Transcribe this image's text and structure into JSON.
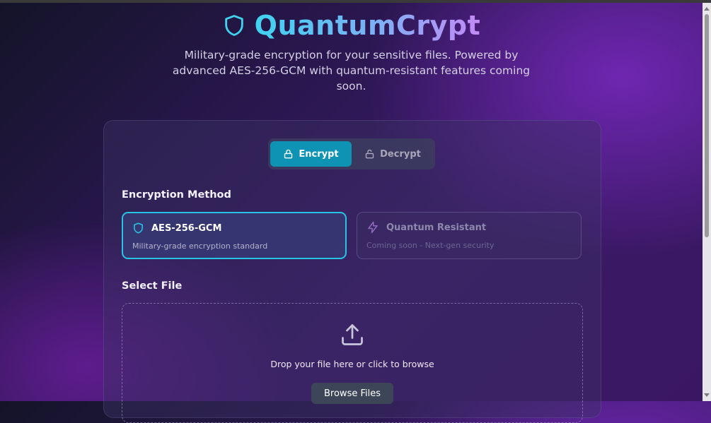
{
  "app": {
    "title": "QuantumCrypt",
    "subtitle": "Military-grade encryption for your sensitive files. Powered by advanced AES-256-GCM with quantum-resistant features coming soon."
  },
  "tabs": [
    {
      "label": "Encrypt",
      "icon": "lock-icon",
      "active": true
    },
    {
      "label": "Decrypt",
      "icon": "unlock-icon",
      "active": false
    }
  ],
  "encryption_method": {
    "heading": "Encryption Method",
    "options": [
      {
        "name": "AES-256-GCM",
        "description": "Military-grade encryption standard",
        "icon": "shield-icon",
        "selected": true
      },
      {
        "name": "Quantum Resistant",
        "description": "Coming soon - Next-gen security",
        "icon": "lightning-icon",
        "selected": false
      }
    ]
  },
  "file": {
    "heading": "Select File",
    "drop_text": "Drop your file here or click to browse",
    "browse_label": "Browse Files",
    "icon": "upload-icon"
  },
  "colors": {
    "accent": "#0e93b5",
    "accent_border": "#27c4e6",
    "title_gradient": [
      "#3fd3f0",
      "#c38af5"
    ]
  }
}
